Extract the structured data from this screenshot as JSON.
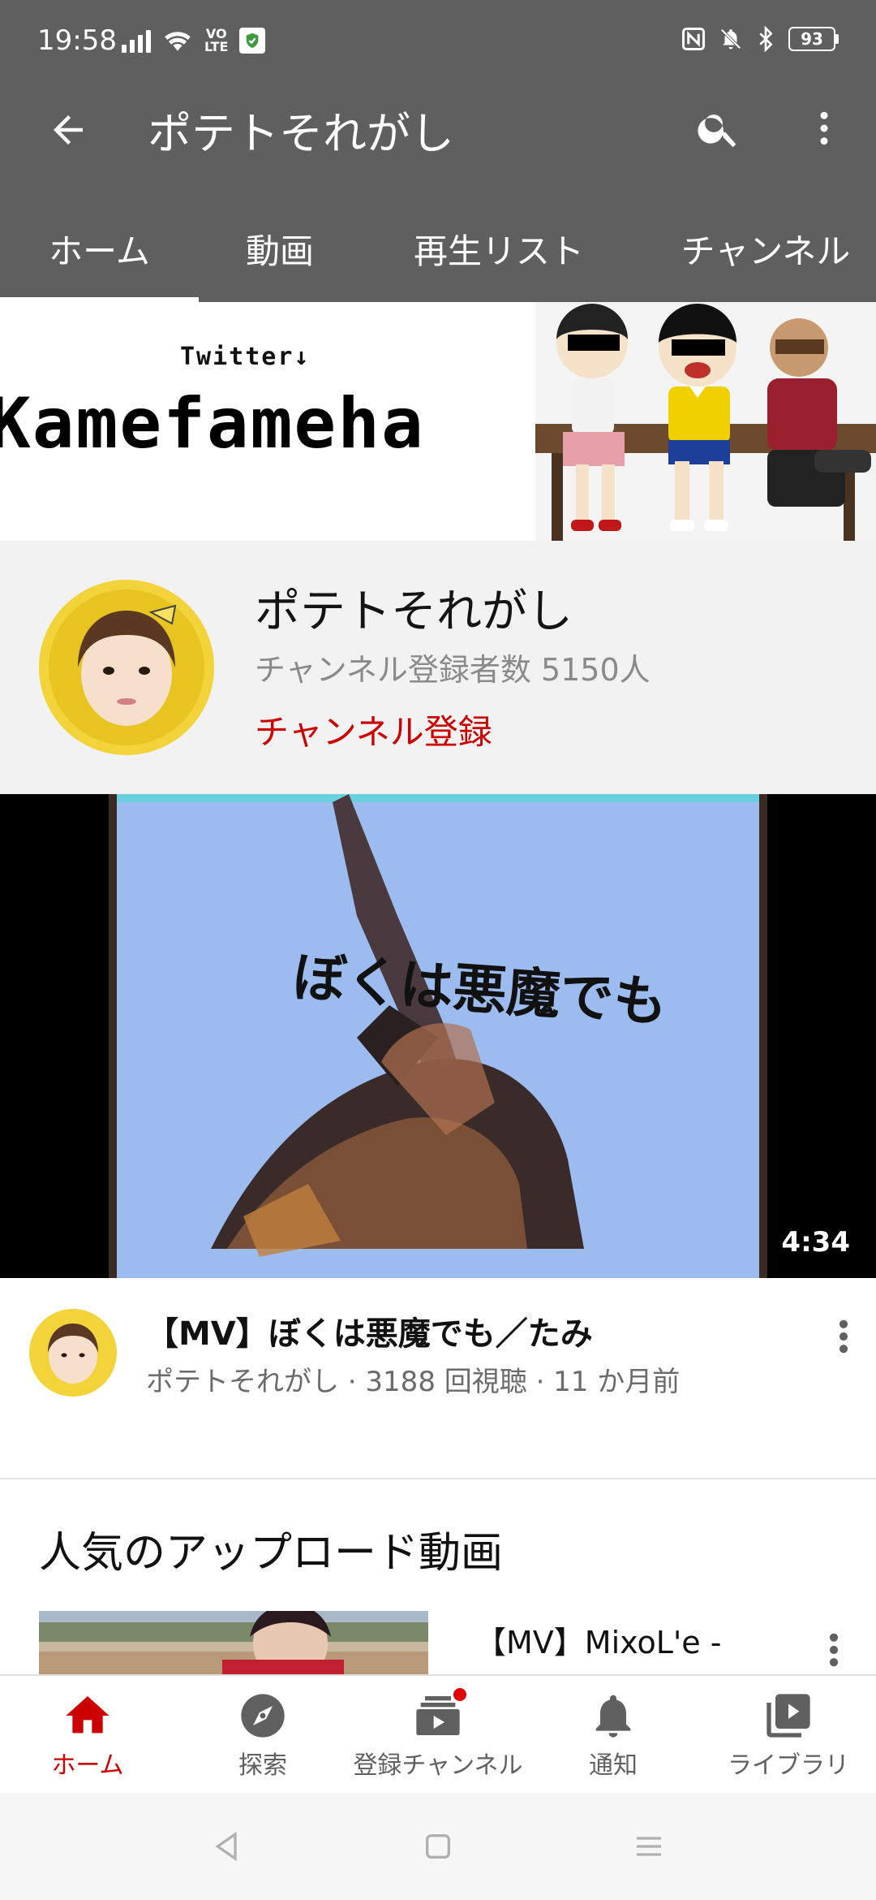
{
  "status_bar": {
    "time": "19:58",
    "battery_level": "93",
    "left_icons": [
      "signal-icon",
      "wifi-icon",
      "volte-icon",
      "shield-icon"
    ],
    "right_icons": [
      "nfc-icon",
      "bell-off-icon",
      "bluetooth-icon",
      "battery-icon"
    ]
  },
  "app_bar": {
    "title": "ポテトそれがし",
    "icons": [
      "back-arrow-icon",
      "search-icon",
      "more-vertical-icon"
    ],
    "background": "#5f5f5f"
  },
  "tabs": [
    {
      "label": "ホーム",
      "selected": true
    },
    {
      "label": "動画",
      "selected": false
    },
    {
      "label": "再生リスト",
      "selected": false
    },
    {
      "label": "チャンネル",
      "selected": false
    }
  ],
  "banner": {
    "twitter_label": "Twitter↓",
    "handle": "Kamefameha"
  },
  "channel": {
    "name": "ポテトそれがし",
    "subscribers": "チャンネル登録者数 5150人",
    "subscribe_label": "チャンネル登録",
    "subscribe_color": "#cc0000"
  },
  "featured_video": {
    "duration": "4:34",
    "title": "【MV】ぼくは悪魔でも／たみ",
    "meta": "ポテトそれがし · 3188 回視聴 · 11 か月前"
  },
  "popular": {
    "section_title": "人気のアップロード動画",
    "first_item_title": "【MV】MixoL'e -"
  },
  "bottom_nav": [
    {
      "label": "ホーム",
      "icon": "home-icon",
      "active": true
    },
    {
      "label": "探索",
      "icon": "compass-icon",
      "active": false
    },
    {
      "label": "登録チャンネル",
      "icon": "subscriptions-icon",
      "active": false
    },
    {
      "label": "通知",
      "icon": "bell-icon",
      "active": false
    },
    {
      "label": "ライブラリ",
      "icon": "library-icon",
      "active": false
    }
  ],
  "system_nav": [
    "back-triangle-icon",
    "home-square-icon",
    "recents-menu-icon"
  ],
  "accent_color": "#cc0000"
}
